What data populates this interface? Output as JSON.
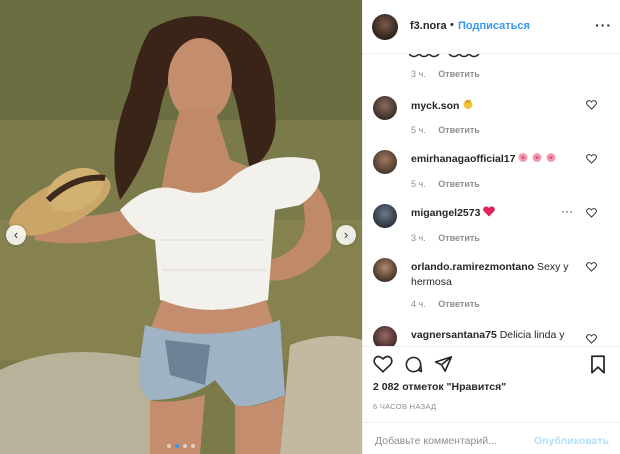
{
  "post": {
    "username": "f3.nora",
    "separator": "•",
    "follow_label": "Подписаться",
    "more_label": "···"
  },
  "carousel": {
    "prev_glyph": "‹",
    "next_glyph": "›",
    "dot_count": 4,
    "active_dot": 1
  },
  "comments": [
    {
      "username": "",
      "text": "",
      "time": "3 ч.",
      "reply_label": "Ответить"
    },
    {
      "username": "myck.son",
      "text": "",
      "emoji": "clap-icon",
      "time": "5 ч.",
      "reply_label": "Ответить"
    },
    {
      "username": "emirhanagaofficial17",
      "text": "",
      "emoji": "flowers-icon",
      "time": "5 ч.",
      "reply_label": "Ответить"
    },
    {
      "username": "migangel2573",
      "text": "",
      "emoji": "red-heart-icon",
      "time": "3 ч.",
      "reply_label": "Ответить",
      "more_label": "···"
    },
    {
      "username": "orlando.ramirezmontano",
      "text": "Sexy y hermosa",
      "time": "4 ч.",
      "reply_label": "Ответить"
    },
    {
      "username": "vagnersantana75",
      "text": "Delicia linda y",
      "time": "",
      "reply_label": ""
    }
  ],
  "likes_text": "2 082 отметок \"Нравится\"",
  "time_ago": "6 ЧАСОВ НАЗАД",
  "add_comment": {
    "placeholder": "Добавьте комментарий...",
    "publish_label": "Опубликовать"
  },
  "colors": {
    "link_blue": "#3897f0",
    "publish_disabled": "#b2dffc",
    "heart_red": "#ed4956",
    "muted": "#8e8e8e"
  }
}
